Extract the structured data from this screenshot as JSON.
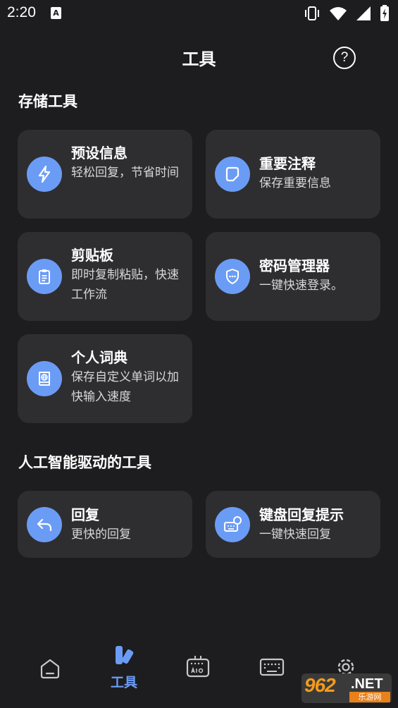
{
  "status_bar": {
    "time": "2:20",
    "notification_letter": "A",
    "icons": [
      "vibrate-icon",
      "wifi-icon",
      "signal-icon",
      "battery-charging-icon"
    ]
  },
  "header": {
    "title": "工具",
    "help_symbol": "?"
  },
  "sections": [
    {
      "title": "存储工具",
      "cards": [
        {
          "title": "预设信息",
          "subtitle": "轻松回复，节省时间",
          "icon": "lightning-icon"
        },
        {
          "title": "重要注释",
          "subtitle": "保存重要信息",
          "icon": "note-icon"
        },
        {
          "title": "剪贴板",
          "subtitle": "即时复制粘贴，快速工作流",
          "icon": "clipboard-icon"
        },
        {
          "title": "密码管理器",
          "subtitle": "一键快速登录。",
          "icon": "shield-icon"
        },
        {
          "title": "个人词典",
          "subtitle": "保存自定义单词以加快输入速度",
          "icon": "dictionary-icon"
        }
      ]
    },
    {
      "title": "人工智能驱动的工具",
      "cards": [
        {
          "title": "回复",
          "subtitle": "更快的回复",
          "icon": "reply-icon"
        },
        {
          "title": "键盘回复提示",
          "subtitle": "一键快速回复",
          "icon": "keyboard-reply-icon"
        }
      ]
    }
  ],
  "bottom_nav": {
    "items": [
      {
        "name": "home",
        "icon": "home-icon",
        "label": ""
      },
      {
        "name": "tools",
        "icon": "tools-icon",
        "label": "工具",
        "active": true
      },
      {
        "name": "ai-keyboard",
        "icon": "ai-keyboard-icon",
        "label": ""
      },
      {
        "name": "keyboard",
        "icon": "keyboard-icon",
        "label": ""
      },
      {
        "name": "settings",
        "icon": "gear-icon",
        "label": ""
      }
    ]
  },
  "watermark": {
    "number": "962",
    "suffix": ".NET",
    "caption": "乐游网"
  },
  "colors": {
    "background": "#1d1d1f",
    "card": "#2e2e31",
    "accent": "#6b9cf5"
  }
}
